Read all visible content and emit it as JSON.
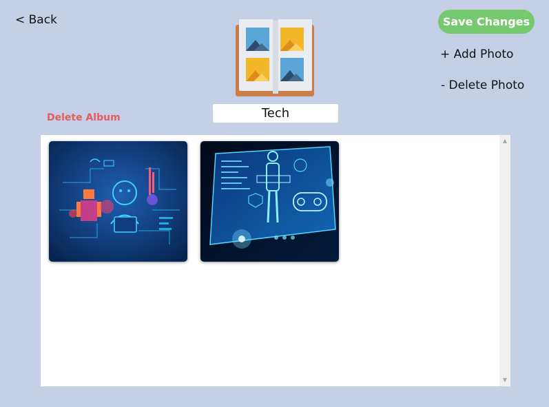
{
  "nav": {
    "back_label": "< Back"
  },
  "album": {
    "title_value": "Tech",
    "icon": "photo-album-icon",
    "delete_label": "Delete Album"
  },
  "actions": {
    "save_label": "Save Changes",
    "add_photo_label": "+ Add Photo",
    "delete_photo_label": "- Delete Photo"
  },
  "gallery": {
    "photos": [
      {
        "icon": "tech-illustration-photo"
      },
      {
        "icon": "holographic-interface-photo"
      }
    ]
  },
  "colors": {
    "background": "#c5cfe5",
    "save_button": "#77c96f",
    "delete_album": "#e35d5d"
  }
}
